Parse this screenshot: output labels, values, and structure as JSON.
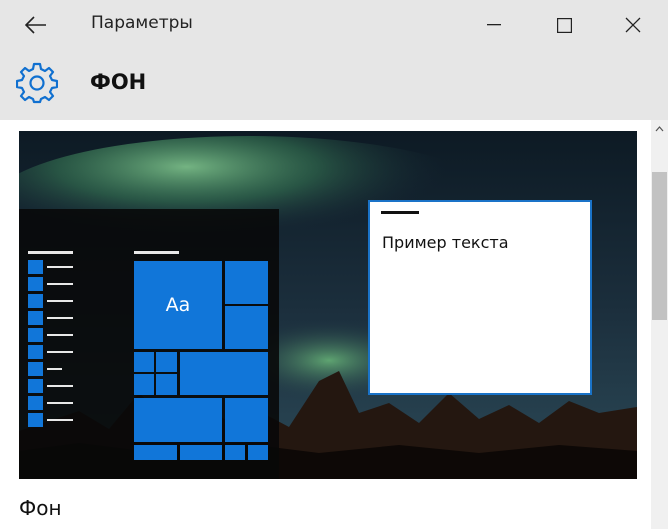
{
  "window": {
    "title": "Параметры"
  },
  "header": {
    "title": "ФОН",
    "icon": "gear-icon"
  },
  "preview": {
    "tile_label": "Aa",
    "sample_text": "Пример текста",
    "accent_color": "#1176d9"
  },
  "section": {
    "label": "Фон"
  },
  "colors": {
    "chrome": "#e6e6e6",
    "accent": "#1176d9"
  }
}
